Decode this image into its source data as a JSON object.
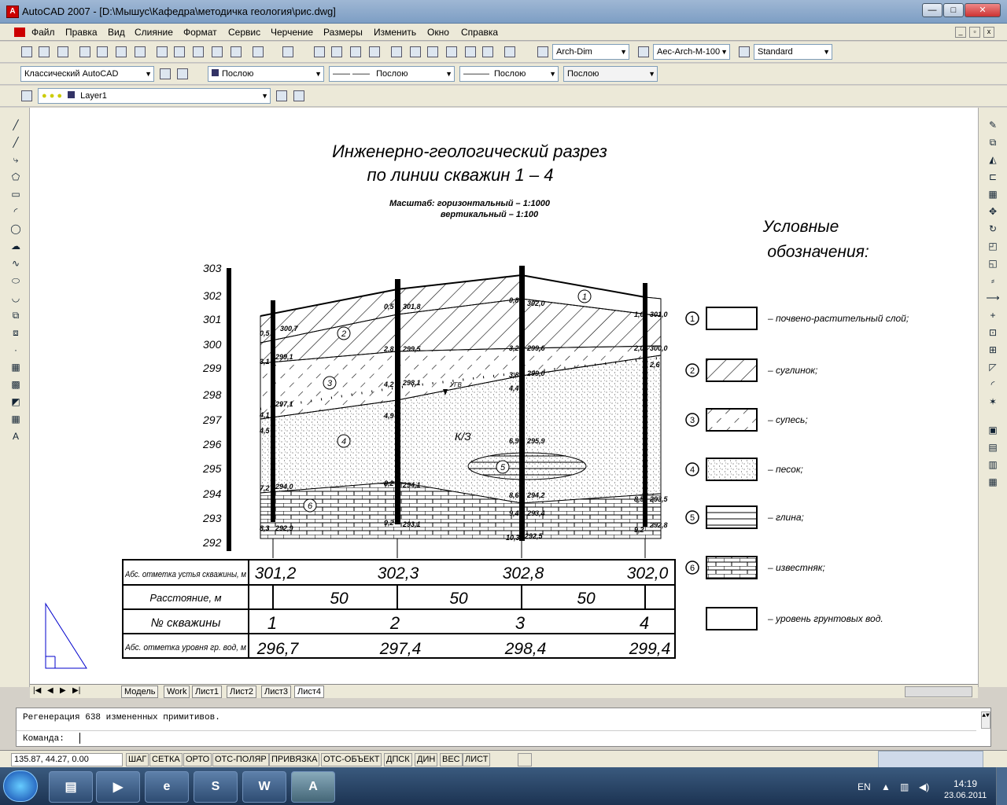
{
  "window": {
    "title": "AutoCAD 2007 - [D:\\Мышус\\Кафедра\\методичка геология\\рис.dwg]",
    "minimize": "—",
    "maximize": "□",
    "close": "✕"
  },
  "menu": [
    "Файл",
    "Правка",
    "Вид",
    "Слияние",
    "Формат",
    "Сервис",
    "Черчение",
    "Размеры",
    "Изменить",
    "Окно",
    "Справка"
  ],
  "toolbar1": {
    "text_style": "Arch-Dim",
    "dim_style": "Aec-Arch-M-100",
    "table_style": "Standard"
  },
  "toolbar2": {
    "workspace": "Классический AutoCAD",
    "color": "Послою",
    "linetype": "Послою",
    "lineweight": "Послою",
    "plotstyle": "Послою"
  },
  "toolbar3": {
    "layer": "Layer1"
  },
  "drawing": {
    "title_line1": "Инженерно-геологический разрез",
    "title_line2": "по линии скважин 1 – 4",
    "scale_line1": "Масштаб: горизонтальный – 1:1000",
    "scale_line2": "вертикальный – 1:100",
    "legend_title1": "Условные",
    "legend_title2": "обозначения:",
    "elevations": [
      "303",
      "302",
      "301",
      "300",
      "299",
      "298",
      "297",
      "296",
      "295",
      "294",
      "293",
      "292"
    ],
    "legend": [
      {
        "num": "1",
        "label": "– почвено-растительный слой;"
      },
      {
        "num": "2",
        "label": "– суглинок;"
      },
      {
        "num": "3",
        "label": "– супесь;"
      },
      {
        "num": "4",
        "label": "– песок;"
      },
      {
        "num": "5",
        "label": "– глина;"
      },
      {
        "num": "6",
        "label": "– известняк;"
      },
      {
        "num": "",
        "label": "– уровень грунтовых вод."
      }
    ],
    "well_labels": [
      "0,5",
      "300,7",
      "3,1",
      "299,1",
      "4,1",
      "297,1",
      "4,5",
      "7,2",
      "294,0",
      "8,3",
      "292,9",
      "0,5",
      "301,8",
      "2,8",
      "299,5",
      "4,2",
      "298,1",
      "4,9",
      "8,2",
      "294,1",
      "9,2",
      "293,1",
      "0,8",
      "302,0",
      "3,2",
      "299,6",
      "3,8",
      "299,0",
      "4,4",
      "6,9",
      "295,9",
      "8,6",
      "294,2",
      "9,4",
      "293,4",
      "10,3",
      "292,5",
      "1,0",
      "301,0",
      "2,0",
      "300,0",
      "2,6",
      "8,5",
      "293,5",
      "9,2",
      "292,8"
    ],
    "layer_nums": [
      "1",
      "2",
      "3",
      "4",
      "5",
      "6"
    ],
    "kz": "К/З",
    "ugv": "УГВ",
    "table": {
      "row1_label": "Абс. отметка устья скважины, м",
      "row1": [
        "301,2",
        "302,3",
        "302,8",
        "302,0"
      ],
      "row2_label": "Расстояние, м",
      "row2": [
        "50",
        "50",
        "50"
      ],
      "row3_label": "№ скважины",
      "row3": [
        "1",
        "2",
        "3",
        "4"
      ],
      "row4_label": "Абс. отметка уровня гр. вод, м",
      "row4": [
        "296,7",
        "297,4",
        "298,4",
        "299,4"
      ]
    }
  },
  "tabs": [
    "Модель",
    "Work",
    "Лист1",
    "Лист2",
    "Лист3",
    "Лист4"
  ],
  "command": {
    "history": "Регенерация 638 измененных примитивов.",
    "prompt": "Команда:"
  },
  "status": {
    "coords": "135.87, 44.27, 0.00",
    "buttons": [
      "ШАГ",
      "СЕТКА",
      "ОРТО",
      "ОТС-ПОЛЯР",
      "ПРИВЯЗКА",
      "ОТС-ОБЪЕКТ",
      "ДПСК",
      "ДИН",
      "ВЕС",
      "ЛИСТ"
    ]
  },
  "taskbar": {
    "lang": "EN",
    "time": "14:19",
    "date": "23.06.2011"
  },
  "colors": {
    "titlebar": "#7d9ec4",
    "canvas": "#ffffff",
    "taskbar": "#1c3352"
  }
}
